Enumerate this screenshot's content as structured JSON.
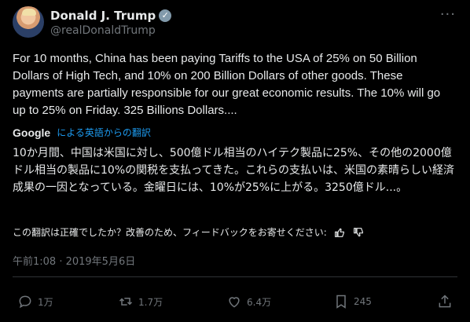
{
  "user": {
    "name": "Donald J. Trump",
    "handle": "@realDonaldTrump",
    "verified_mark": "✓"
  },
  "menu_icon": "more-icon",
  "tweet": {
    "text": "For 10 months, China has been paying Tariffs to the USA of 25% on 50 Billion Dollars of High Tech, and 10% on 200 Billion Dollars of other goods. These payments are partially responsible for our great economic results. The 10% will go up to 25% on Friday. 325 Billions Dollars....",
    "translation_provider": "Google",
    "translated_by": "による英語からの翻訳",
    "translation": "10か月間、中国は米国に対し、500億ドル相当のハイテク製品に25%、その他の2000億ドル相当の製品に10%の関税を支払ってきた。これらの支払いは、米国の素晴らしい経済成果の一因となっている。金曜日には、10%が25%に上がる。3250億ドル...。",
    "feedback_prompt": "この翻訳は正確でしたか？改善のため、フィードバックをお寄せください:",
    "timestamp": "午前1:08 · 2019年5月6日"
  },
  "actions": {
    "reply": "1万",
    "retweet": "1.7万",
    "like": "6.4万",
    "bookmark": "245"
  },
  "colors": {
    "background": "#000000",
    "text": "#e7e9ea",
    "muted": "#71767b",
    "link": "#1d9bf0",
    "verified_badge": "#829aab"
  }
}
